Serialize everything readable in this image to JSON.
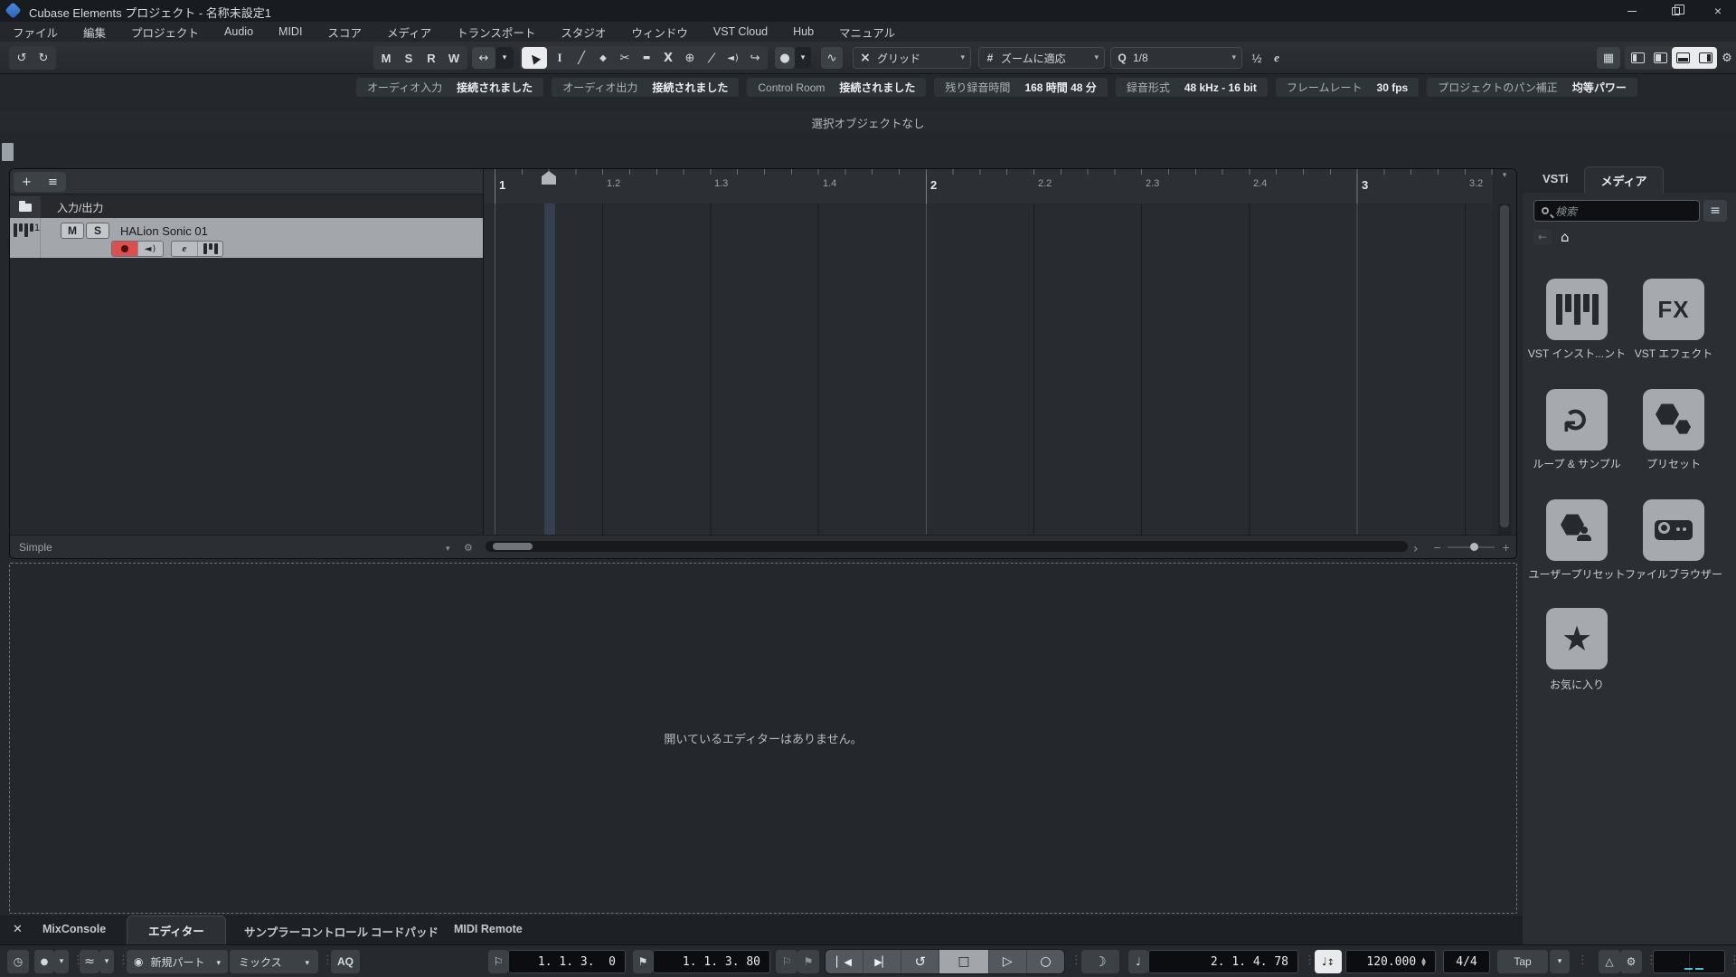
{
  "colors": {
    "accent_blue": "#3a7bd5",
    "record_red": "#dd4f4f",
    "meter_cyan": "#49c0d8",
    "selected_track_gray": "#a3a7ab",
    "active_white": "#e9ebec"
  },
  "title_bar": {
    "title": "Cubase Elements プロジェクト - 名称未設定1"
  },
  "menu_bar": {
    "items": [
      "ファイル",
      "編集",
      "プロジェクト",
      "Audio",
      "MIDI",
      "スコア",
      "メディア",
      "トランスポート",
      "スタジオ",
      "ウィンドウ",
      "VST Cloud",
      "Hub",
      "マニュアル"
    ]
  },
  "toolbar": {
    "automation": {
      "mute": "M",
      "solo": "S",
      "read": "R",
      "write": "W"
    },
    "snap_type_label": "グリッド",
    "grid_type_icon": "#",
    "zoom_preset_label": "ズームに適応",
    "quantize_icon": "Q",
    "quantize_label": "1/8",
    "swing_label": "½",
    "quantize_edit_label": "e"
  },
  "info_bar": {
    "items": [
      {
        "label": "オーディオ入力",
        "value": "接続されました"
      },
      {
        "label": "オーディオ出力",
        "value": "接続されました"
      },
      {
        "label": "Control Room",
        "value": "接続されました"
      },
      {
        "label": "残り録音時間",
        "value": "168 時間 48 分"
      },
      {
        "label": "録音形式",
        "value": "48 kHz - 16 bit"
      },
      {
        "label": "フレームレート",
        "value": "30 fps"
      },
      {
        "label": "プロジェクトのパン補正",
        "value": "均等パワー"
      }
    ]
  },
  "status_line": {
    "text": "選択オブジェクトなし"
  },
  "project_window": {
    "folder_track_label": "入力/出力",
    "track": {
      "number": "1",
      "mute_label": "M",
      "solo_label": "S",
      "name": "HALion Sonic 01",
      "edit_label": "e"
    },
    "ruler_ticks": [
      "1",
      "1.2",
      "1.3",
      "1.4",
      "2",
      "2.2",
      "2.3",
      "2.4",
      "3",
      "3.2"
    ],
    "footer_preset": "Simple"
  },
  "lower_zone": {
    "tabs": [
      "MixConsole",
      "エディター",
      "サンプラーコントロール",
      "コードパッド",
      "MIDI Remote"
    ],
    "active_tab": "エディター",
    "empty_message": "開いているエディターはありません。"
  },
  "right_zone": {
    "tabs": [
      "VSTi",
      "メディア"
    ],
    "active_tab": "メディア",
    "search_placeholder": "検索",
    "tiles": [
      {
        "label": "VST インスト...ント"
      },
      {
        "label": "VST エフェクト",
        "badge": "FX"
      },
      {
        "label": "ループ & サンプル"
      },
      {
        "label": "プリセット"
      },
      {
        "label": "ユーザープリセット"
      },
      {
        "label": "ファイルブラウザー"
      },
      {
        "label": "お気に入り"
      }
    ]
  },
  "transport": {
    "midi_insert_mode": "新規パート",
    "audio_insert_mode": "ミックス",
    "aq_label": "AQ",
    "left_locator": "1. 1. 3.  0",
    "right_locator": "1. 1. 3. 80",
    "position": "2. 1. 4. 78",
    "tempo": "120.000",
    "time_signature": "4/4",
    "tap_label": "Tap"
  }
}
